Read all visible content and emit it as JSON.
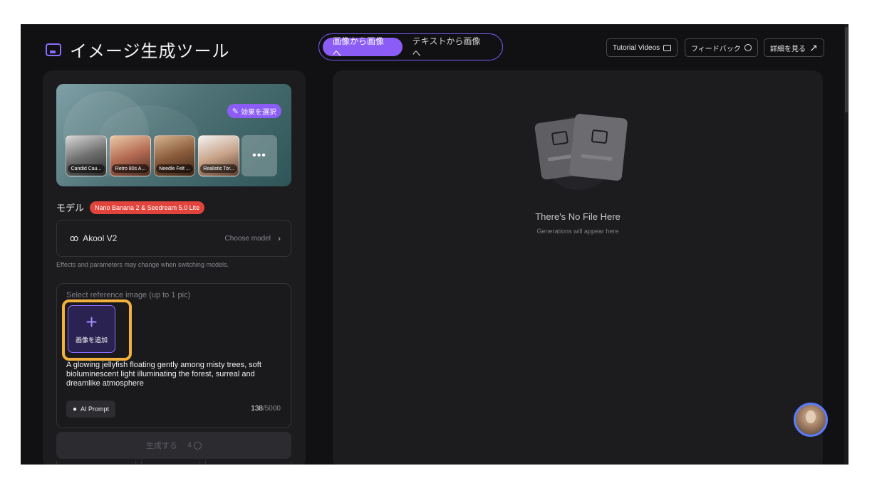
{
  "header": {
    "title": "イメージ生成ツール",
    "title_icon": "image-spark-icon",
    "modes": [
      "画像から画像へ",
      "テキストから画像へ"
    ],
    "active_mode": "画像から画像へ",
    "buttons": {
      "tutorial": "Tutorial Videos",
      "feedback": "フィードバック",
      "details": "詳細を見る"
    }
  },
  "effects": {
    "select_label": "効果を選択",
    "thumbnails": [
      "Candid Cau...",
      "Retro 80s A...",
      "Needle Felt ...",
      "Realistic Tor..."
    ],
    "more": "•••"
  },
  "model": {
    "label": "モデル",
    "badge": "Nano Banana 2 & Seedream 5.0 Lite",
    "current": "Akool V2",
    "choose": "Choose model",
    "note": "Effects and parameters may change when switching models."
  },
  "reference": {
    "hint": "Select reference image (up to 1 pic)",
    "add_label": "画像を追加",
    "prompt": "A glowing jellyfish floating gently among misty trees, soft bioluminescent light illuminating the forest, surreal and dreamlike atmosphere",
    "ai_prompt": "AI Prompt",
    "count": "138",
    "max": "/5000"
  },
  "generate": {
    "label": "生成する",
    "cost": "4"
  },
  "empty_state": {
    "title": "There's No File Here",
    "subtitle": "Generations will appear here"
  },
  "colors": {
    "accent": "#8b5cf6",
    "badge_red": "#e0443c",
    "highlight": "#f2b13d",
    "background": "#111113",
    "panel": "#1c1c1f"
  }
}
